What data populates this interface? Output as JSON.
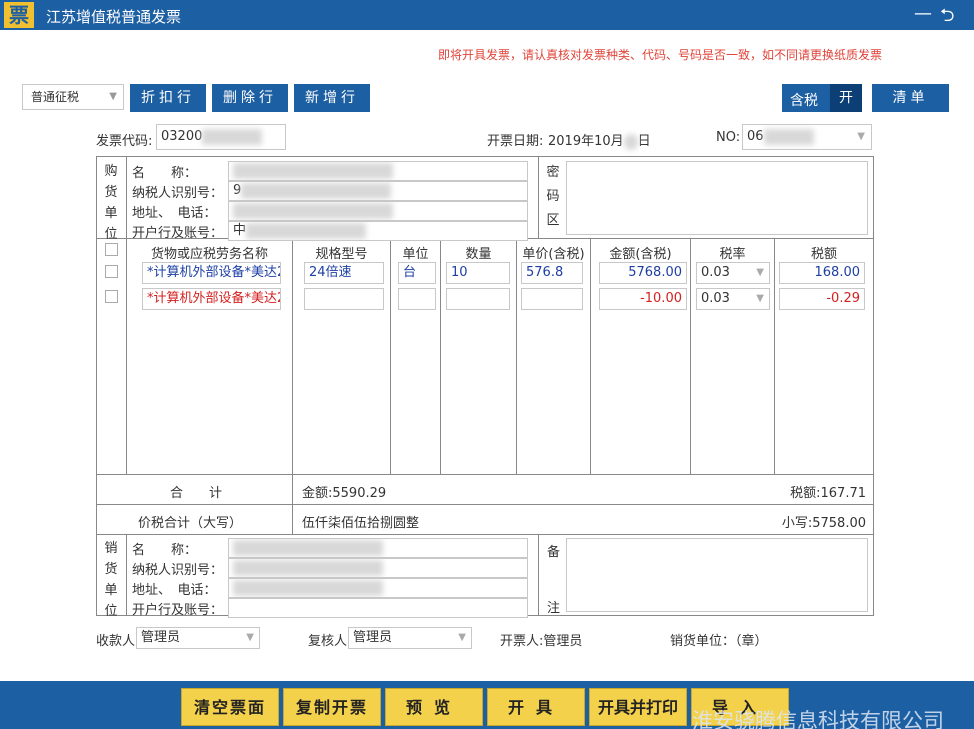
{
  "titlebar": {
    "logo": "票",
    "title": "江苏增值税普通发票",
    "minimize": "—",
    "back": "⮌"
  },
  "notice": "即将开具发票，请认真核对发票种类、代码、号码是否一致，如不同请更换纸质发票",
  "toolbar": {
    "tax_type": "普通征税",
    "discount_row": "折扣行",
    "delete_row": "删除行",
    "add_row": "新增行",
    "tax_inclusive": "含税",
    "tax_toggle": "开",
    "list": "清单"
  },
  "header": {
    "code_label": "发票代码:",
    "code_value": "03200",
    "date_label": "开票日期:",
    "date_value_prefix": "2019年10月",
    "date_value_suffix": "日",
    "no_label": "NO:",
    "no_value": "06"
  },
  "buyer": {
    "side_label": [
      "购",
      "货",
      "单",
      "位"
    ],
    "name_label": "名　　称：",
    "name_value": "",
    "tax_id_label": "纳税人识别号：",
    "tax_id_value": "9",
    "address_label": "地址、　电话：",
    "address_value": "",
    "bank_label": "开户行及账号：",
    "bank_value": "中",
    "secret_label": [
      "密",
      "码",
      "区"
    ]
  },
  "items": {
    "columns": [
      "货物或应税劳务名称",
      "规格型号",
      "单位",
      "数量",
      "单价(含税)",
      "金额(含税)",
      "税率",
      "税额"
    ],
    "rows": [
      {
        "name": "*计算机外部设备*美达2",
        "spec": "24倍速",
        "unit": "台",
        "qty": "10",
        "price": "576.8",
        "amount": "5768.00",
        "rate": "0.03",
        "tax": "168.00"
      },
      {
        "name": "*计算机外部设备*美达2",
        "spec": "",
        "unit": "",
        "qty": "",
        "price": "",
        "amount": "-10.00",
        "rate": "0.03",
        "tax": "-0.29"
      }
    ]
  },
  "totals": {
    "label": "合　　计",
    "amount": "金额:5590.29",
    "tax": "税额:167.71",
    "upper_label": "价税合计（大写）",
    "upper_value": "伍仟柒佰伍拾捌圆整",
    "lower_value": "小写:5758.00"
  },
  "seller": {
    "side_label": [
      "销",
      "货",
      "单",
      "位"
    ],
    "name_label": "名　　称：",
    "tax_id_label": "纳税人识别号：",
    "address_label": "地址、　电话：",
    "bank_label": "开户行及账号：",
    "note_label": [
      "备",
      "注"
    ]
  },
  "signers": {
    "payee_label": "收款人:",
    "payee_value": "管理员",
    "reviewer_label": "复核人:",
    "reviewer_value": "管理员",
    "drawer": "开票人:管理员",
    "seller_seal": "销货单位：（章）"
  },
  "footer": {
    "clear": "清空票面",
    "copy": "复制开票",
    "preview": "预览",
    "issue": "开具",
    "issue_print": "开具并打印",
    "import": "导入",
    "watermark": "淮安骁腾信息科技有限公司"
  }
}
